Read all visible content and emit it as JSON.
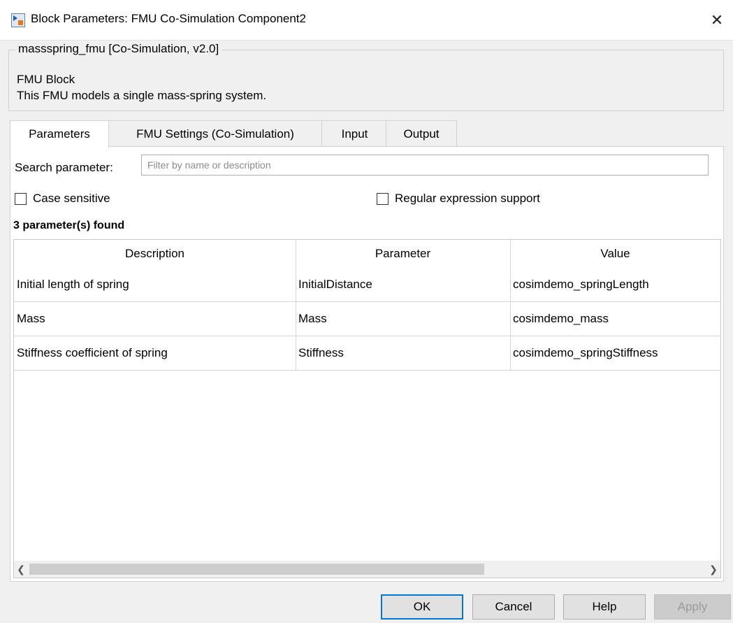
{
  "window": {
    "title": "Block Parameters: FMU Co-Simulation Component2",
    "close_icon": "✕"
  },
  "header": {
    "group_legend": "massspring_fmu [Co-Simulation, v2.0]",
    "block_type": "FMU Block",
    "block_description": "This FMU models a single mass-spring system."
  },
  "tabs": [
    {
      "label": "Parameters",
      "active": true
    },
    {
      "label": "FMU Settings (Co-Simulation)",
      "active": false
    },
    {
      "label": "Input",
      "active": false
    },
    {
      "label": "Output",
      "active": false
    }
  ],
  "search": {
    "label": "Search parameter:",
    "value": "",
    "placeholder": "Filter by name or description"
  },
  "options": {
    "case_sensitive": {
      "label": "Case sensitive",
      "checked": false
    },
    "regex": {
      "label": "Regular expression support",
      "checked": false
    }
  },
  "results": {
    "found_text": "3 parameter(s) found"
  },
  "table": {
    "columns": [
      "Description",
      "Parameter",
      "Value"
    ],
    "rows": [
      [
        "Initial length of spring",
        "InitialDistance",
        "cosimdemo_springLength"
      ],
      [
        "Mass",
        "Mass",
        "cosimdemo_mass"
      ],
      [
        "Stiffness coefficient of spring",
        "Stiffness",
        "cosimdemo_springStiffness"
      ]
    ]
  },
  "buttons": {
    "ok": "OK",
    "cancel": "Cancel",
    "help": "Help",
    "apply": "Apply"
  },
  "colors": {
    "accent": "#0078d7",
    "window_bg": "#f0f0f0",
    "panel_bg": "#ffffff"
  }
}
